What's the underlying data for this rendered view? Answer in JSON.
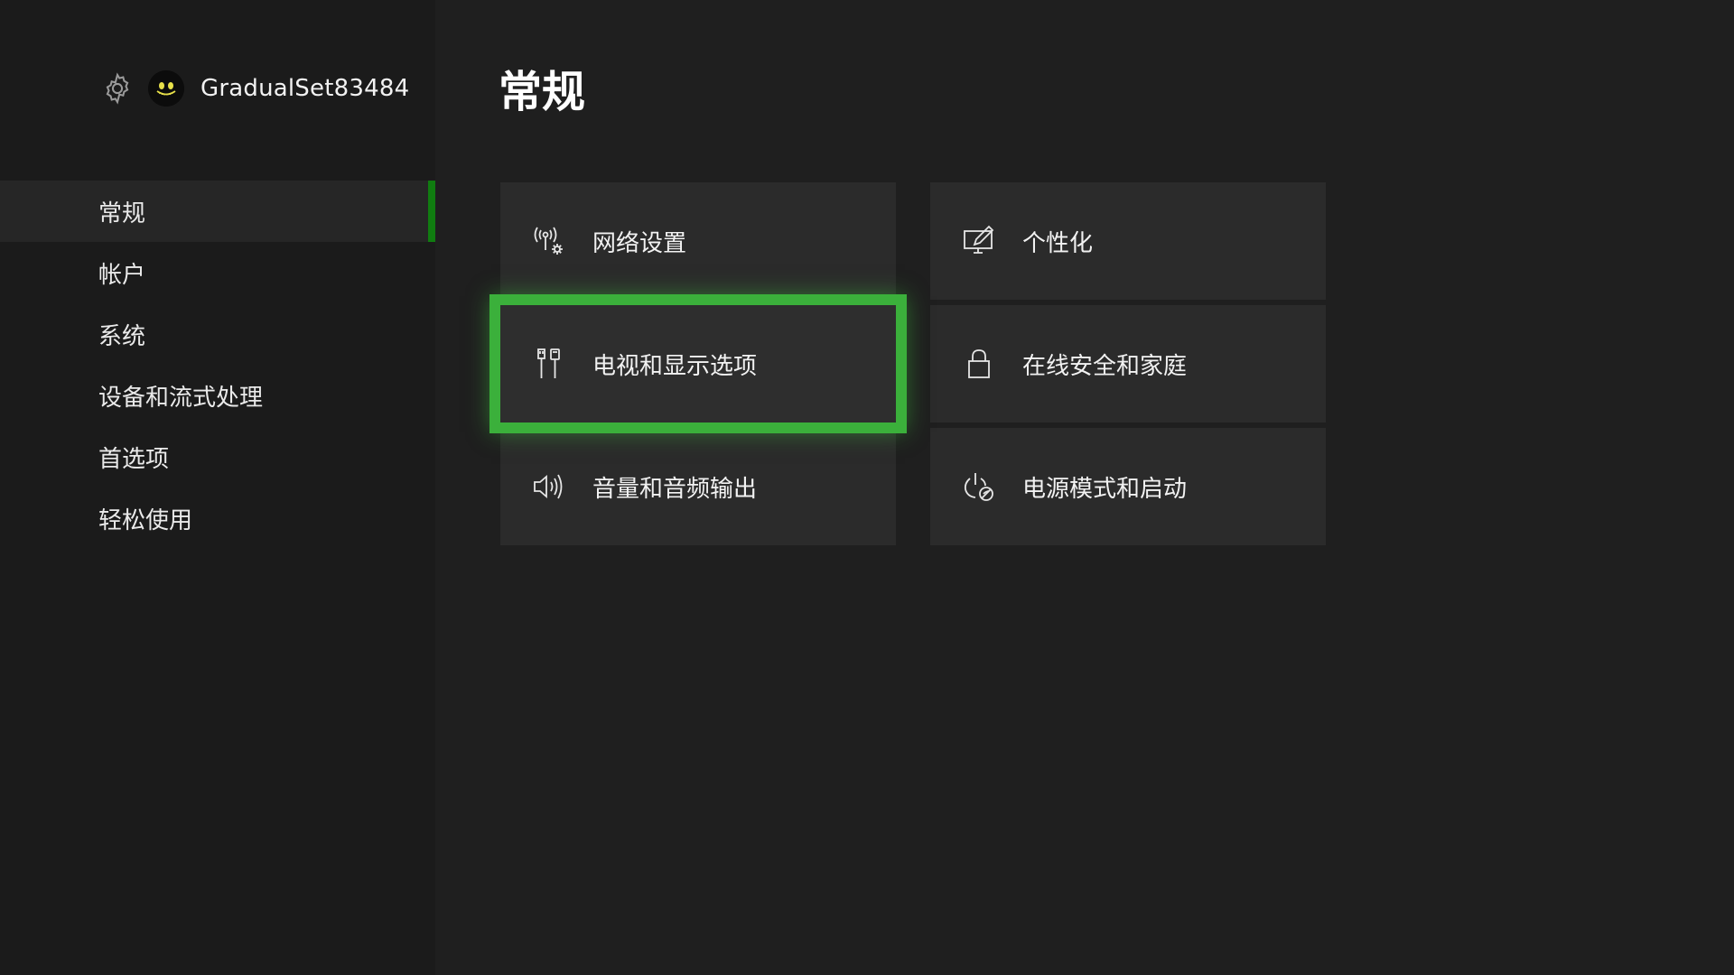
{
  "header": {
    "gamertag": "GradualSet83484",
    "settings_icon": "gear-icon",
    "avatar_icon": "avatar-face-icon"
  },
  "sidebar": {
    "items": [
      {
        "label": "常规",
        "selected": true
      },
      {
        "label": "帐户",
        "selected": false
      },
      {
        "label": "系统",
        "selected": false
      },
      {
        "label": "设备和流式处理",
        "selected": false
      },
      {
        "label": "首选项",
        "selected": false
      },
      {
        "label": "轻松使用",
        "selected": false
      }
    ]
  },
  "main": {
    "title": "常规",
    "tiles": [
      {
        "label": "网络设置",
        "icon": "network-settings-icon",
        "focused": false
      },
      {
        "label": "个性化",
        "icon": "personalization-icon",
        "focused": false
      },
      {
        "label": "电视和显示选项",
        "icon": "tv-display-icon",
        "focused": true
      },
      {
        "label": "在线安全和家庭",
        "icon": "lock-icon",
        "focused": false
      },
      {
        "label": "音量和音频输出",
        "icon": "volume-icon",
        "focused": false
      },
      {
        "label": "电源模式和启动",
        "icon": "power-mode-icon",
        "focused": false
      }
    ]
  },
  "colors": {
    "accent_green": "#107c10",
    "focus_green": "#3bb03b",
    "background": "#1f1f1f",
    "sidebar_background": "#1b1b1b",
    "tile_background": "#2b2b2b"
  }
}
